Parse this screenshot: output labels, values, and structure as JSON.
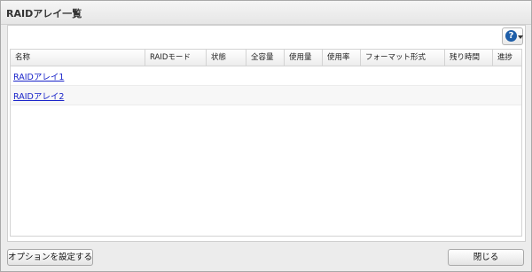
{
  "dialog": {
    "title": "RAIDアレイ一覧"
  },
  "help": {
    "glyph": "?"
  },
  "table": {
    "columns": [
      "名称",
      "RAIDモード",
      "状態",
      "全容量",
      "使用量",
      "使用率",
      "フォーマット形式",
      "残り時間",
      "進捗"
    ],
    "rows": [
      {
        "name": "RAIDアレイ1"
      },
      {
        "name": "RAIDアレイ2"
      }
    ]
  },
  "footer": {
    "options_label": "オプションを設定する",
    "close_label": "閉じる"
  },
  "colors": {
    "accent": "#1e5ea8",
    "link": "#1a24c9"
  }
}
